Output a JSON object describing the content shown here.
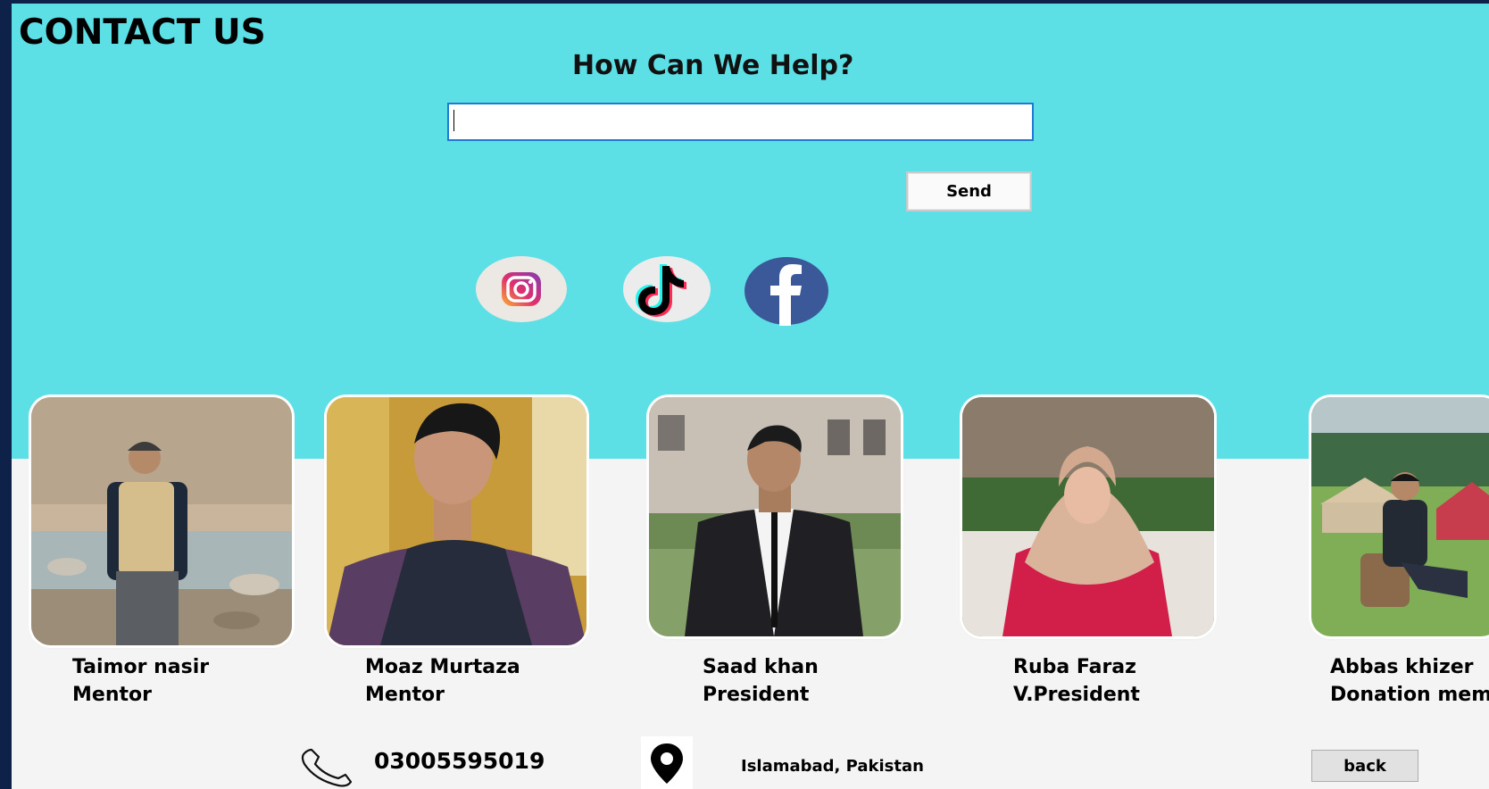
{
  "page": {
    "title": "CONTACT US",
    "help_heading": "How Can We Help?"
  },
  "form": {
    "input_value": "",
    "input_placeholder": "",
    "send_label": "Send"
  },
  "social": [
    {
      "icon": "instagram-icon"
    },
    {
      "icon": "tiktok-icon"
    },
    {
      "icon": "facebook-icon"
    }
  ],
  "team": [
    {
      "name": "Taimor nasir",
      "role": "Mentor"
    },
    {
      "name": "Moaz Murtaza",
      "role": "Mentor"
    },
    {
      "name": "Saad khan",
      "role": "President"
    },
    {
      "name": "Ruba Faraz",
      "role": "V.President"
    },
    {
      "name": "Abbas khizer",
      "role": "Donation mem"
    }
  ],
  "contact": {
    "phone": "03005595019",
    "address": "Islamabad, Pakistan",
    "phone_icon": "phone-icon",
    "location_icon": "location-pin-icon"
  },
  "nav": {
    "back_label": "back"
  },
  "colors": {
    "top_band": "#5ddfe6",
    "lower_area": "#f4f4f4",
    "frame": "#0d2149",
    "input_border": "#1e7ad3"
  }
}
